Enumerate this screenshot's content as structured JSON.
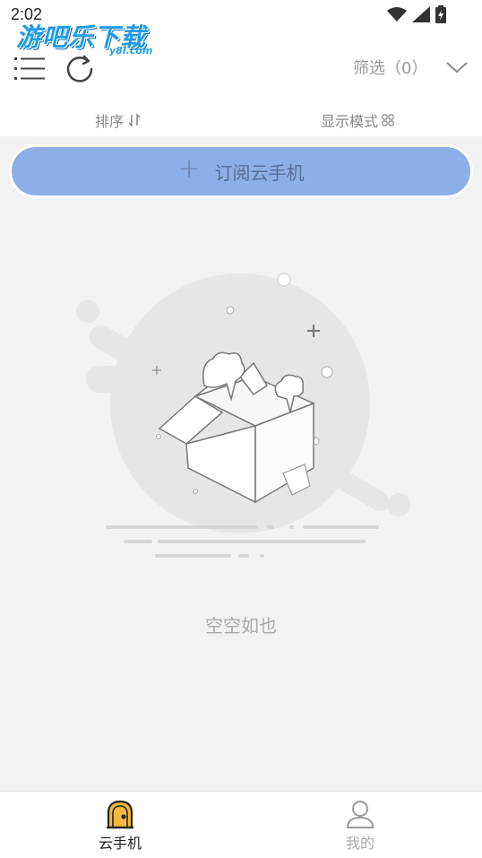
{
  "status_bar": {
    "time": "2:02"
  },
  "logo": {
    "main": "游吧乐下载",
    "sub": "y8l.com"
  },
  "header": {
    "filter_label": "筛选（0）",
    "sort_label": "排序",
    "display_mode_label": "显示模式"
  },
  "subscribe_button": {
    "label": "订阅云手机"
  },
  "empty_state": {
    "text": "空空如也"
  },
  "bottom_nav": {
    "items": [
      {
        "label": "云手机",
        "active": true
      },
      {
        "label": "我的",
        "active": false
      }
    ]
  },
  "colors": {
    "accent_button": "#8eaee7",
    "nav_active_icon": "#f6b93b",
    "logo_blue": "#1e9ce8"
  }
}
